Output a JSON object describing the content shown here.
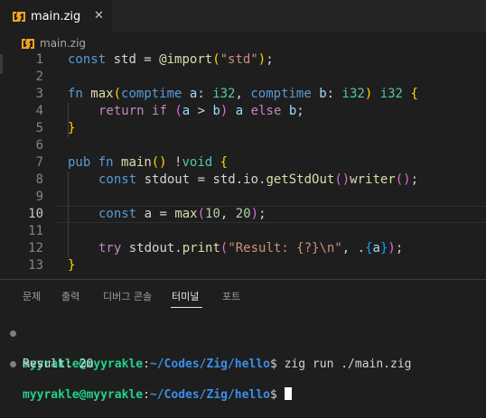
{
  "colors": {
    "editor_bg": "#1e1e1e",
    "tab_bar_bg": "#252526",
    "zig_icon": "#f7a41d",
    "prompt_user": "#23d18b",
    "prompt_path": "#3b8eea"
  },
  "tab": {
    "icon": "zig-file-icon",
    "label": "main.zig",
    "close_icon": "close-icon",
    "close_glyph": "✕"
  },
  "breadcrumb": {
    "icon": "zig-file-icon",
    "label": "main.zig"
  },
  "editor": {
    "current_line": 10,
    "line_numbers": [
      "1",
      "2",
      "3",
      "4",
      "5",
      "6",
      "7",
      "8",
      "9",
      "10",
      "11",
      "12",
      "13"
    ],
    "lines": {
      "l1": {
        "a": "const",
        "b": " std = ",
        "c": "@import",
        "d": "(",
        "e": "\"std\"",
        "f": ")",
        ";": ";"
      },
      "l3": {
        "a": "fn",
        "b": " ",
        "c": "max",
        "d": "(",
        "e": "comptime",
        "f": " ",
        "g": "a",
        "h": ": ",
        "i": "i32",
        "j": ", ",
        "k": "comptime",
        "l": " ",
        "m": "b",
        "n": ": ",
        "o": "i32",
        "p": ")",
        "q": " ",
        "r": "i32",
        "s": " ",
        "t": "{"
      },
      "l4": {
        "a": "return",
        "b": " ",
        "c": "if",
        "d": " ",
        "e": "(",
        "f": "a",
        "g": " > ",
        "h": "b",
        "i": ")",
        "j": " ",
        "k": "a",
        "l": " ",
        "m": "else",
        "n": " ",
        "o": "b",
        ";": ";"
      },
      "l5": {
        "a": "}"
      },
      "l7": {
        "a": "pub",
        "b": " ",
        "c": "fn",
        "d": " ",
        "e": "main",
        "f": "()",
        "g": " !",
        "h": "void",
        "i": " ",
        "j": "{"
      },
      "l8": {
        "a": "const",
        "b": " stdout = std.io.",
        "c": "getStdOut",
        "d": "()",
        ".": ".",
        "e": "writer",
        "f": "()",
        ";": ";"
      },
      "l10": {
        "a": "const",
        "b": " a = ",
        "c": "max",
        "d": "(",
        "e": "10",
        "f": ", ",
        "g": "20",
        "h": ")",
        ";": ";"
      },
      "l12": {
        "a": "try",
        "b": " stdout.",
        "c": "print",
        "d": "(",
        "e": "\"Result: {?}\\n\"",
        "f": ", .",
        "g": "{",
        "h": "a",
        "i": "}",
        "j": ")",
        ";": ";"
      },
      "l13": {
        "a": "}"
      }
    }
  },
  "panel": {
    "tabs": [
      "문제",
      "출력",
      "디버그 콘솔",
      "터미널",
      "포트"
    ],
    "active_tab": "터미널"
  },
  "terminal": {
    "lines": [
      {
        "user": "myyrakle@myyrakle",
        "sep": ":",
        "path": "~/Codes/Zig/hello",
        "dollar": "$",
        "command": " zig run ./main.zig"
      },
      {
        "output": "Result: 20"
      },
      {
        "user": "myyrakle@myyrakle",
        "sep": ":",
        "path": "~/Codes/Zig/hello",
        "dollar": "$",
        "command": " "
      }
    ]
  }
}
